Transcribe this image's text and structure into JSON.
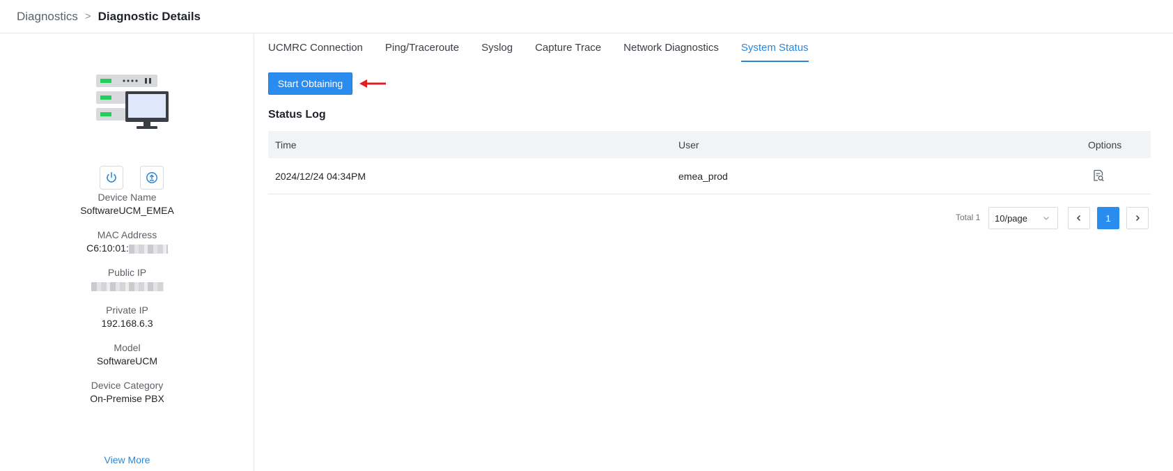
{
  "breadcrumb": {
    "root": "Diagnostics",
    "separator": ">",
    "current": "Diagnostic Details"
  },
  "device": {
    "fields": [
      {
        "label": "Device Name",
        "value": "SoftwareUCM_EMEA"
      },
      {
        "label": "MAC Address",
        "value": "C6:10:01:"
      },
      {
        "label": "Public IP",
        "value": ""
      },
      {
        "label": "Private IP",
        "value": "192.168.6.3"
      },
      {
        "label": "Model",
        "value": "SoftwareUCM"
      },
      {
        "label": "Device Category",
        "value": "On-Premise PBX"
      }
    ],
    "view_more": "View More",
    "icons": {
      "power": "power-icon",
      "upload": "upload-icon",
      "device": "server-computer-icon"
    }
  },
  "tabs": [
    {
      "label": "UCMRC Connection",
      "active": false
    },
    {
      "label": "Ping/Traceroute",
      "active": false
    },
    {
      "label": "Syslog",
      "active": false
    },
    {
      "label": "Capture Trace",
      "active": false
    },
    {
      "label": "Network Diagnostics",
      "active": false
    },
    {
      "label": "System Status",
      "active": true
    }
  ],
  "actions": {
    "start_label": "Start Obtaining"
  },
  "status_log": {
    "title": "Status Log",
    "columns": [
      "Time",
      "User",
      "Options"
    ],
    "rows": [
      {
        "time": "2024/12/24 04:34PM",
        "user": "emea_prod"
      }
    ]
  },
  "pagination": {
    "total_label": "Total 1",
    "page_size": "10/page",
    "current_page": "1"
  },
  "colors": {
    "accent": "#2b8cf0",
    "link": "#2b86d9",
    "annotation_arrow": "#e02020"
  }
}
